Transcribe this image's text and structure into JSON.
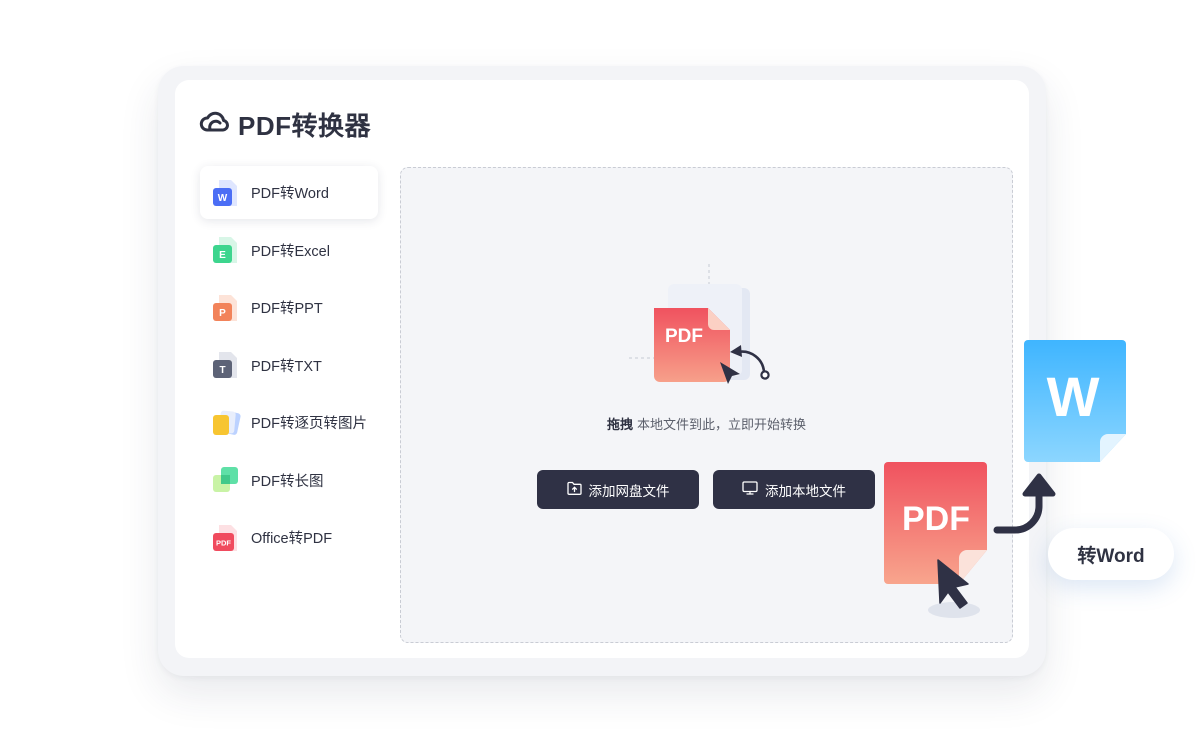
{
  "app": {
    "title": "PDF转换器",
    "logo_icon": "cloud-icon"
  },
  "sidebar": {
    "items": [
      {
        "label": "PDF转Word",
        "icon": "word-file-icon",
        "icon_color": "#4b6ef5",
        "active": true
      },
      {
        "label": "PDF转Excel",
        "icon": "excel-file-icon",
        "icon_color": "#3dd58e",
        "active": false
      },
      {
        "label": "PDF转PPT",
        "icon": "ppt-file-icon",
        "icon_color": "#f2835a",
        "active": false
      },
      {
        "label": "PDF转TXT",
        "icon": "txt-file-icon",
        "icon_color": "#5d6377",
        "active": false
      },
      {
        "label": "PDF转逐页转图片",
        "icon": "image-pages-icon",
        "icon_color": "#f7c531",
        "active": false
      },
      {
        "label": "PDF转长图",
        "icon": "long-image-icon",
        "icon_color": "#41c98a",
        "active": false
      },
      {
        "label": "Office转PDF",
        "icon": "pdf-file-icon",
        "icon_color": "#f04b5e",
        "active": false
      }
    ]
  },
  "dropzone": {
    "illustration_text": "PDF",
    "hint_strong": "拖拽",
    "hint_text": "本地文件到此，立即开始转换",
    "buttons": {
      "cloud_label": "添加网盘文件",
      "local_label": "添加本地文件"
    }
  },
  "decor": {
    "pdf_card_text": "PDF",
    "word_card_text": "W",
    "badge_text": "转Word"
  },
  "colors": {
    "accent_dark": "#2f3145",
    "word_blue": "#3fb5ff",
    "pdf_red": "#f0525f"
  }
}
